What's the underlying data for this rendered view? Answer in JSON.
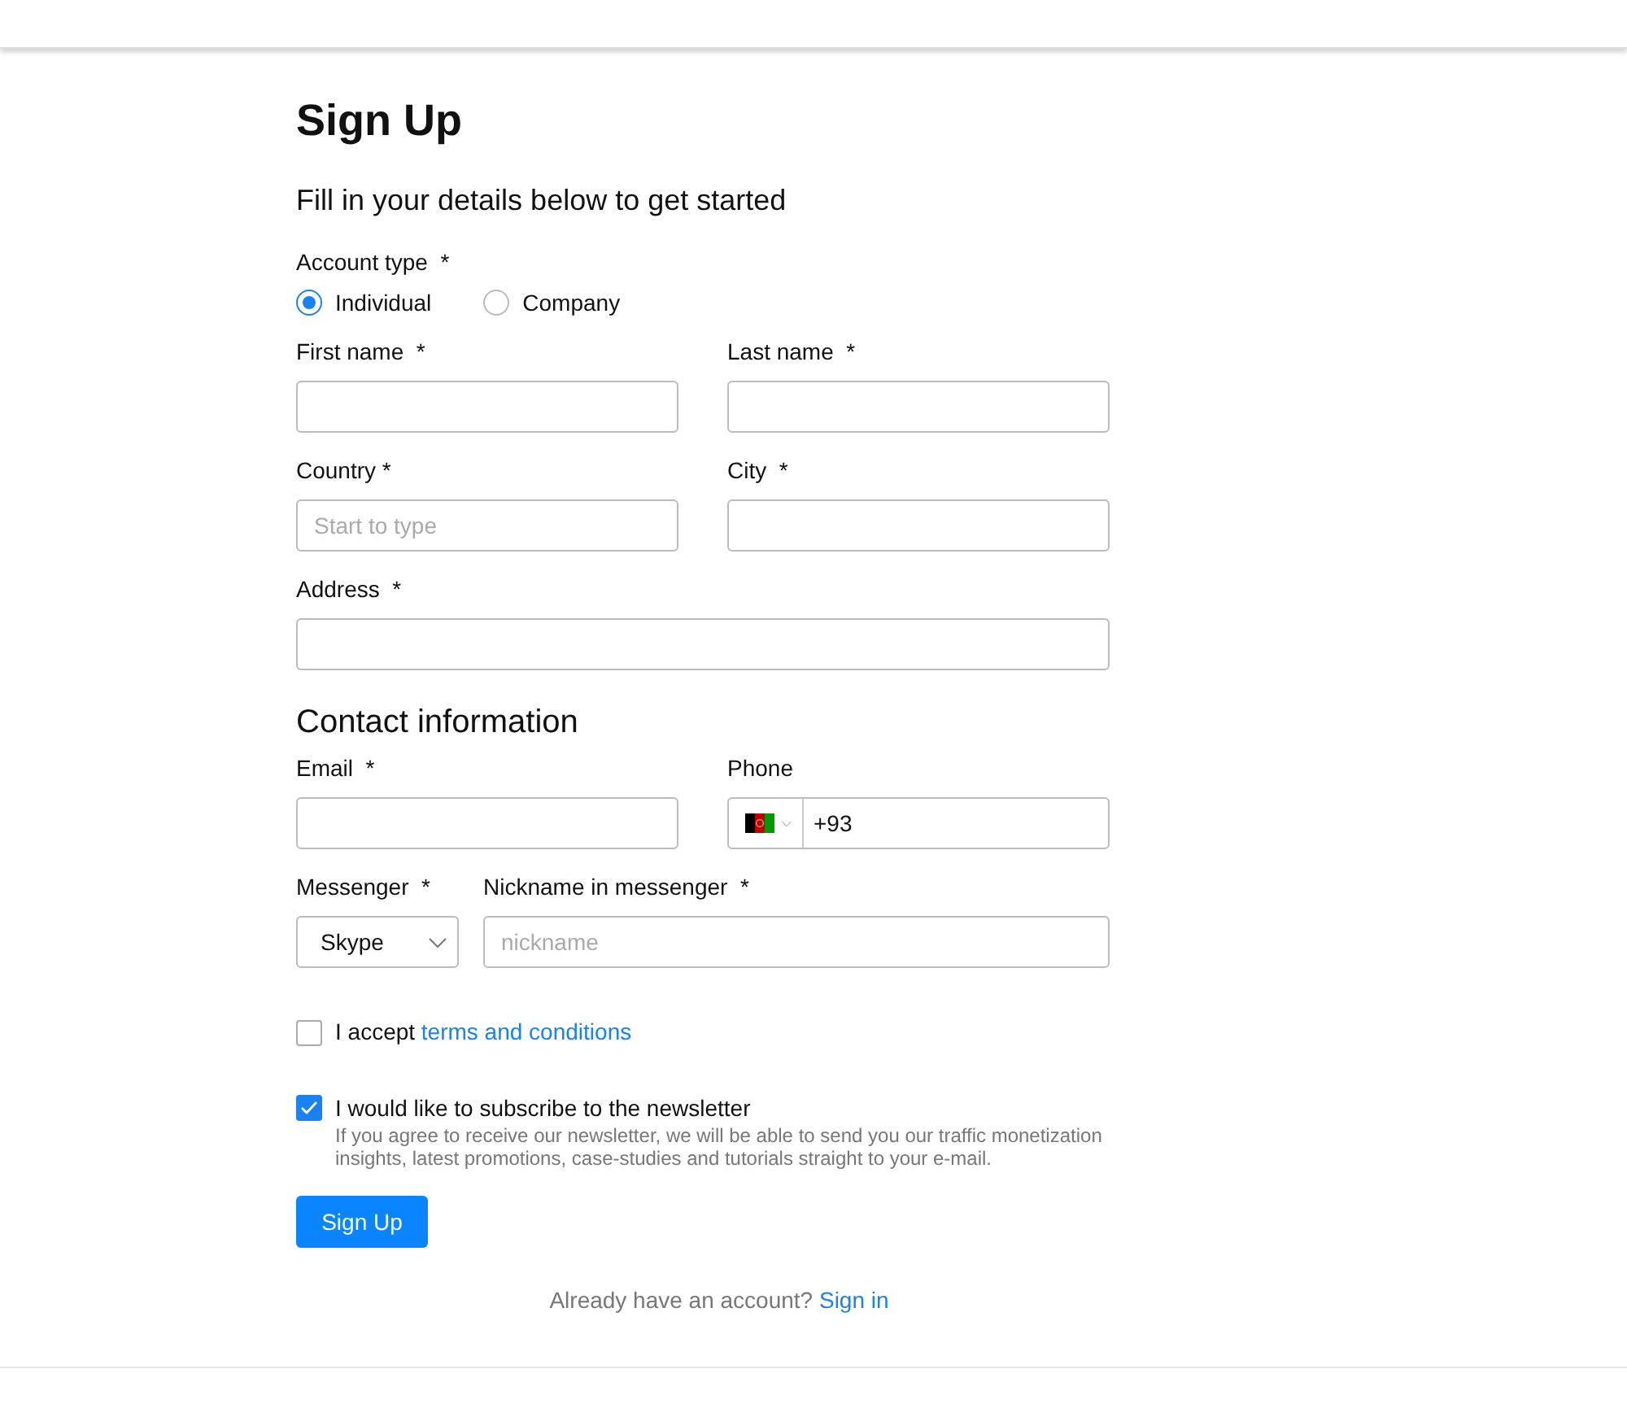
{
  "title": "Sign Up",
  "subtitle": "Fill in your details below to get started",
  "account_type": {
    "label": "Account type  *",
    "options": [
      {
        "label": "Individual",
        "selected": true
      },
      {
        "label": "Company",
        "selected": false
      }
    ]
  },
  "rows": [
    [
      {
        "kind": "text",
        "label": "First name  *"
      },
      {
        "kind": "text",
        "label": "Last name  *"
      }
    ],
    [
      {
        "kind": "text",
        "label": "Country *",
        "placeholder": "Start to type"
      },
      {
        "kind": "text",
        "label": "City  *"
      }
    ],
    [
      {
        "kind": "text",
        "label": "Address  *"
      }
    ]
  ],
  "contact_heading": "Contact information",
  "contact_rows": [
    [
      {
        "kind": "text",
        "label": "Email  *"
      },
      {
        "kind": "phone",
        "label": "Phone",
        "value": "+93"
      }
    ],
    [
      {
        "kind": "select",
        "label": "Messenger  *",
        "value": "Skype"
      },
      {
        "kind": "text",
        "label": "Nickname in messenger  *",
        "placeholder": "nickname"
      }
    ]
  ],
  "terms": {
    "checked": false,
    "text": "I accept ",
    "link": "terms and conditions"
  },
  "newsletter": {
    "checked": true,
    "text": "I would like to subscribe to the newsletter",
    "note": "If you agree to receive our newsletter, we will be able to send you our traffic monetization insights, latest promotions, case-studies and tutorials straight to your e-mail."
  },
  "submit": "Sign Up",
  "signin": {
    "text": "Already have an account? ",
    "link": "Sign in"
  }
}
